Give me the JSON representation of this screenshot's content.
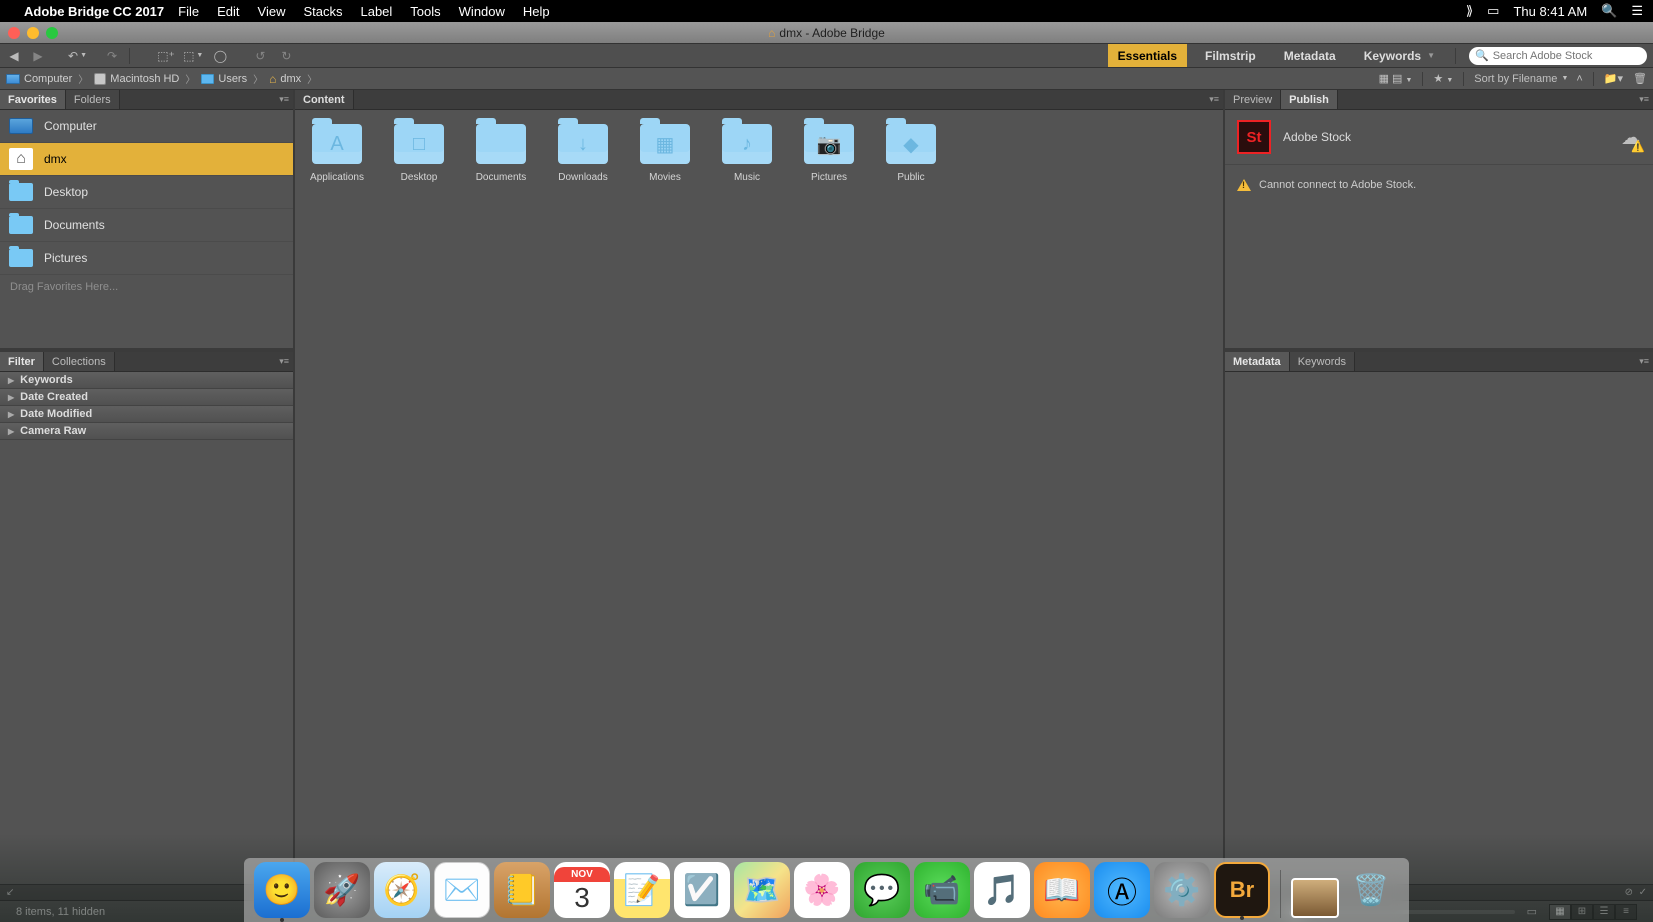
{
  "menubar": {
    "app_name": "Adobe Bridge CC 2017",
    "menus": [
      "File",
      "Edit",
      "View",
      "Stacks",
      "Label",
      "Tools",
      "Window",
      "Help"
    ],
    "time": "Thu 8:41 AM"
  },
  "titlebar": {
    "title": "dmx - Adobe Bridge"
  },
  "toolbar": {
    "workspaces": [
      "Essentials",
      "Filmstrip",
      "Metadata",
      "Keywords"
    ],
    "active_workspace": "Essentials",
    "search_placeholder": "Search Adobe Stock"
  },
  "pathbar": {
    "crumbs": [
      "Computer",
      "Macintosh HD",
      "Users",
      "dmx"
    ],
    "sort_label": "Sort by Filename"
  },
  "left": {
    "tabs_top": [
      "Favorites",
      "Folders"
    ],
    "favorites": [
      {
        "label": "Computer",
        "icon": "computer"
      },
      {
        "label": "dmx",
        "icon": "home",
        "selected": true
      },
      {
        "label": "Desktop",
        "icon": "folder"
      },
      {
        "label": "Documents",
        "icon": "folder"
      },
      {
        "label": "Pictures",
        "icon": "folder"
      }
    ],
    "fav_hint": "Drag Favorites Here...",
    "tabs_bottom": [
      "Filter",
      "Collections"
    ],
    "filters": [
      "Keywords",
      "Date Created",
      "Date Modified",
      "Camera Raw"
    ]
  },
  "content": {
    "tab": "Content",
    "folders": [
      {
        "label": "Applications",
        "glyph": "A"
      },
      {
        "label": "Desktop",
        "glyph": "□"
      },
      {
        "label": "Documents",
        "glyph": ""
      },
      {
        "label": "Downloads",
        "glyph": "↓"
      },
      {
        "label": "Movies",
        "glyph": "▦"
      },
      {
        "label": "Music",
        "glyph": "♪"
      },
      {
        "label": "Pictures",
        "glyph": "📷"
      },
      {
        "label": "Public",
        "glyph": "◆"
      }
    ]
  },
  "right": {
    "tabs_top": [
      "Preview",
      "Publish"
    ],
    "publish": {
      "title": "Adobe Stock",
      "logo": "St",
      "error": "Cannot connect to Adobe Stock."
    },
    "tabs_bottom": [
      "Metadata",
      "Keywords"
    ]
  },
  "statusbar": {
    "text": "8 items, 11 hidden"
  },
  "dock": {
    "calendar": {
      "month": "NOV",
      "day": "3"
    },
    "bridge": "Br"
  }
}
